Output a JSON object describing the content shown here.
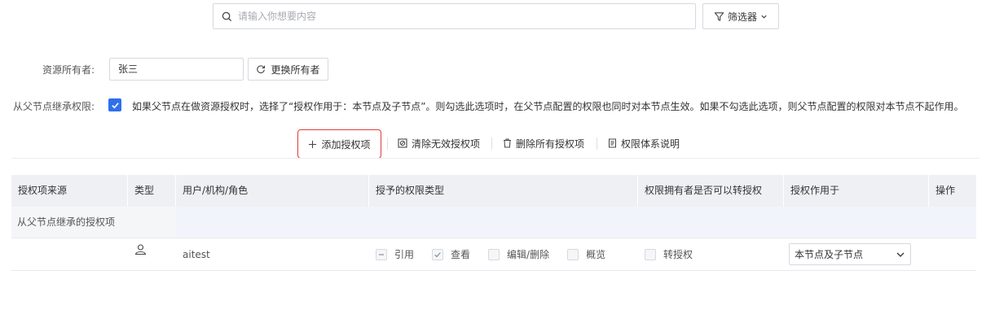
{
  "search": {
    "placeholder": "请输入你想要内容"
  },
  "filter": {
    "label": "筛选器"
  },
  "owner": {
    "label": "资源所有者:",
    "value": "张三",
    "change_button": "更换所有者"
  },
  "inherit": {
    "label": "从父节点继承权限:",
    "checked": true,
    "description": "如果父节点在做资源授权时，选择了“授权作用于：本节点及子节点”。则勾选此选项时，在父节点配置的权限也同时对本节点生效。如果不勾选此选项，则父节点配置的权限对本节点不起作用。"
  },
  "toolbar": {
    "add": "添加授权项",
    "clear_invalid": "清除无效授权项",
    "delete_all": "删除所有授权项",
    "help": "权限体系说明"
  },
  "table": {
    "columns": [
      "授权项来源",
      "类型",
      "用户/机构/角色",
      "授予的权限类型",
      "权限拥有者是否可以转授权",
      "授权作用于",
      "操作"
    ],
    "group_label": "从父节点继承的授权项",
    "rows": [
      {
        "source": "",
        "type_icon": "user-icon",
        "name": "aitest",
        "perms": [
          {
            "label": "引用",
            "state": "indeterminate"
          },
          {
            "label": "查看",
            "state": "checked"
          },
          {
            "label": "编辑/删除",
            "state": "unchecked"
          },
          {
            "label": "概览",
            "state": "unchecked"
          }
        ],
        "regrant": {
          "label": "转授权",
          "state": "unchecked"
        },
        "scope": "本节点及子节点"
      }
    ]
  },
  "colors": {
    "primary": "#2f6fed",
    "highlight_border": "#e03a3a",
    "header_bg": "#eef0f4"
  }
}
